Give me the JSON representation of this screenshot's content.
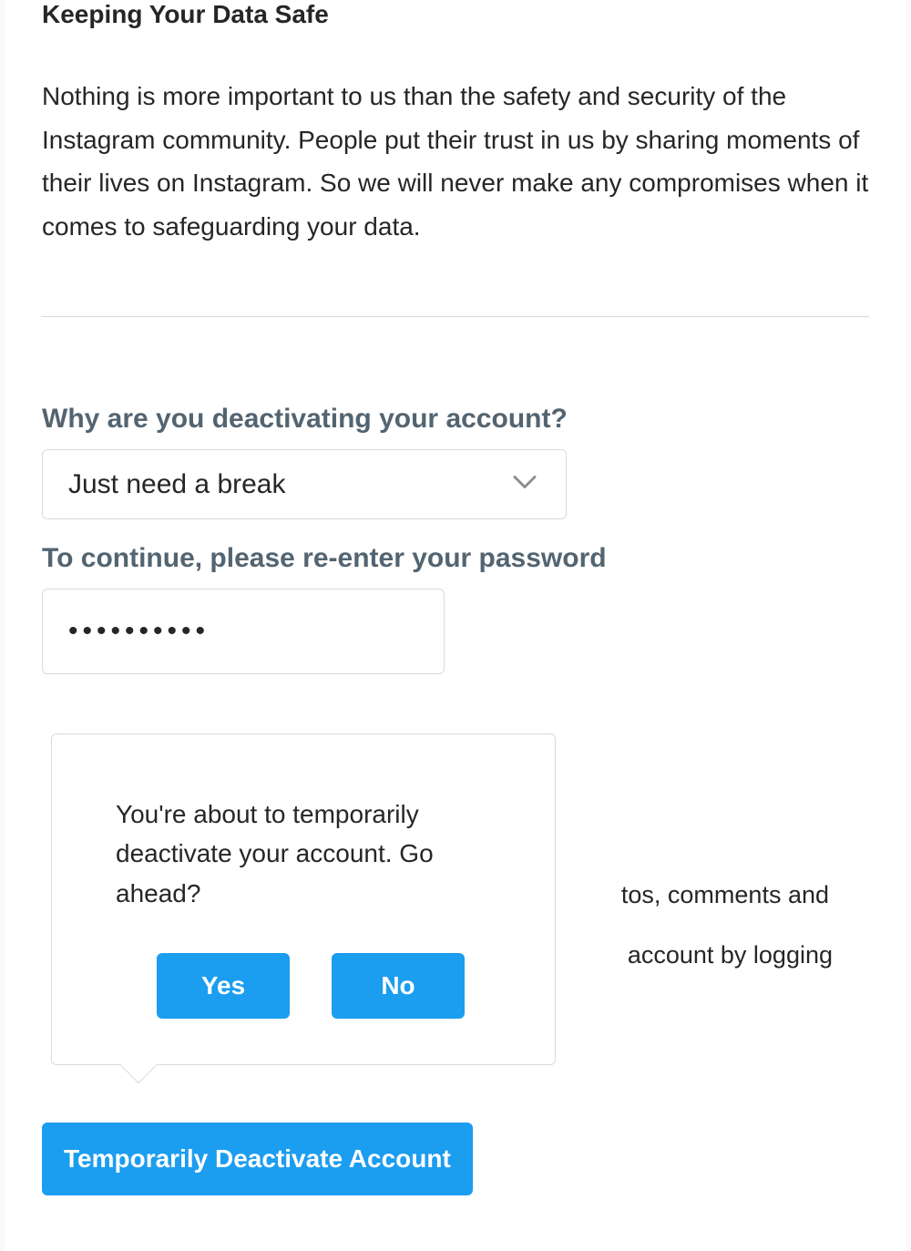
{
  "safety": {
    "heading": "Keeping Your Data Safe",
    "body": "Nothing is more important to us than the safety and security of the Instagram community. People put their trust in us by sharing moments of their lives on Instagram. So we will never make any compromises when it comes to safeguarding your data."
  },
  "form": {
    "reason_label": "Why are you deactivating your account?",
    "reason_value": "Just need a break",
    "password_label": "To continue, please re-enter your password",
    "password_value": "••••••••••"
  },
  "info": {
    "line1_partial": "tos, comments and",
    "line2_partial": "account by logging"
  },
  "buttons": {
    "deactivate": "Temporarily Deactivate Account"
  },
  "confirm": {
    "message": "You're about to temporarily deactivate your account. Go ahead?",
    "yes": "Yes",
    "no": "No"
  }
}
